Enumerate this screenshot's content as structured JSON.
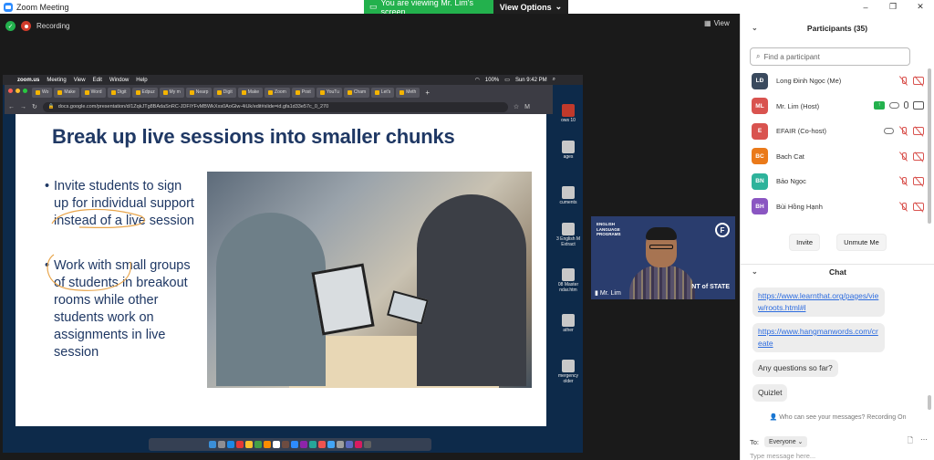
{
  "window": {
    "title": "Zoom Meeting",
    "controls": [
      "–",
      "❐",
      "✕"
    ]
  },
  "banner": {
    "viewing": "You are viewing Mr. Lim's screen",
    "options": "View Options"
  },
  "meeting": {
    "recording": "Recording",
    "view": "View"
  },
  "mac": {
    "menu": [
      "zoom.us",
      "Meeting",
      "View",
      "Edit",
      "Window",
      "Help"
    ],
    "battery": "100%",
    "clock": "Sun 9:42 PM"
  },
  "browser": {
    "tabs": [
      "Wo",
      "Make",
      "Word",
      "Digit",
      "Edpuz",
      "My m",
      "Nearp",
      "Digit",
      "Make",
      "Zoom",
      "Post",
      "YouTu",
      "Cham",
      "Let's",
      "Meth"
    ],
    "url": "docs.google.com/presentation/d/1ZqkJTg8BAdaSnRC-JDFiYFvMBWkXxs0AoGlw-4iUk/edit#slide=id.gfa1d33e57c_0_270",
    "profile": "M"
  },
  "slide": {
    "title": "Break up live sessions into smaller chunks",
    "bullets": [
      "Invite students to sign up for individual support instead of a live session",
      "Work with small groups of students in breakout rooms while other students work on assignments in live session"
    ]
  },
  "desktop": {
    "items": [
      "ows 10",
      "ages",
      "cuments",
      "3 English M Extract",
      "08 Master ndar.htm",
      "ather",
      "mergency older"
    ]
  },
  "speaker": {
    "logo_lines": [
      "ENGLISH",
      "LANGUAGE",
      "PROGRAMS"
    ],
    "badge": "F",
    "state_text": "NT of STATE",
    "name": "Mr. Lim"
  },
  "participants": {
    "title": "Participants (35)",
    "search_placeholder": "Find a participant",
    "list": [
      {
        "initials": "LĐ",
        "name": "Long Đinh Ngọc (Me)",
        "color": "#3a4a5e"
      },
      {
        "initials": "ML",
        "name": "Mr. Lim (Host)",
        "color": "#d9534f"
      },
      {
        "initials": "E",
        "name": "EFAIR (Co-host)",
        "color": "#d9534f"
      },
      {
        "initials": "BC",
        "name": "Bach Cat",
        "color": "#ea7a1a"
      },
      {
        "initials": "BN",
        "name": "Bảo Ngọc",
        "color": "#2eb39b"
      },
      {
        "initials": "BH",
        "name": "Bùi Hồng Hạnh",
        "color": "#8a56c2"
      }
    ],
    "invite": "Invite",
    "unmute": "Unmute Me"
  },
  "chat": {
    "title": "Chat",
    "messages": [
      "https://www.learnthat.org/pages/view/roots.html#l",
      "https://www.hangmanwords.com/create",
      "Any questions so far?",
      "Quizlet"
    ],
    "notice": "Who can see your messages? Recording On",
    "to_label": "To:",
    "to_value": "Everyone",
    "placeholder": "Type message here..."
  }
}
